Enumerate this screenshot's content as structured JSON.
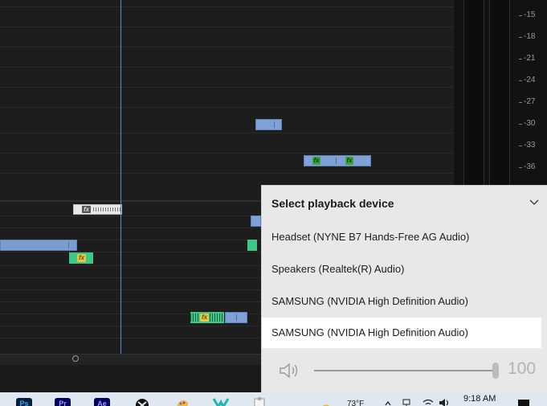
{
  "meter": {
    "ticks": [
      "-15",
      "-18",
      "-21",
      "-24",
      "-27",
      "-30",
      "-33",
      "-36"
    ]
  },
  "flyout": {
    "title": "Select playback device",
    "devices": [
      {
        "label": "Headset (NYNE B7 Hands-Free AG Audio)",
        "selected": false
      },
      {
        "label": "Speakers (Realtek(R) Audio)",
        "selected": false
      },
      {
        "label": "SAMSUNG (NVIDIA High Definition Audio)",
        "selected": false
      },
      {
        "label": "SAMSUNG (NVIDIA High Definition Audio)",
        "selected": true
      }
    ],
    "volume": {
      "value": "100",
      "level": 1.0
    }
  },
  "taskbar": {
    "apps": [
      {
        "name": "photoshop-icon",
        "text": "Ps",
        "bg": "#001e36",
        "fg": "#31a8ff"
      },
      {
        "name": "premiere-icon",
        "text": "Pr",
        "bg": "#00005b",
        "fg": "#9999ff"
      },
      {
        "name": "after-effects-icon",
        "text": "Ae",
        "bg": "#00005b",
        "fg": "#9999ff"
      }
    ],
    "clock_time": "9:18 AM",
    "weather_temp": "73°F"
  },
  "colors": {
    "playhead": "#4d8fd6",
    "clip_blue": "#7ea2d6",
    "clip_green": "#3ec887",
    "fx_green": "#3aa63a"
  }
}
